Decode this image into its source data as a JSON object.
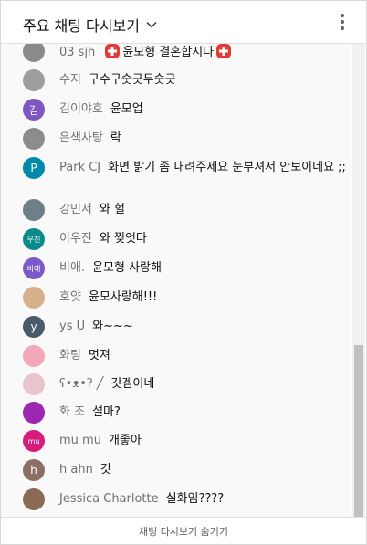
{
  "header": {
    "title": "주요 채팅 다시보기",
    "dropdown_icon": "chevron-down-icon",
    "menu_icon": "more-vert-icon"
  },
  "messages": [
    {
      "author": "03 sjh",
      "text": "윤모형 결혼합시다",
      "avatar_color": "#8a8a8a",
      "avatar_initial": "",
      "emoji": "red-cross"
    },
    {
      "author": "수지",
      "text": "구수구숫긋두숫긋",
      "avatar_color": "#9e9e9e",
      "avatar_initial": ""
    },
    {
      "author": "김이야호",
      "text": "윤모업",
      "avatar_color": "#7e57c2",
      "avatar_initial": "김"
    },
    {
      "author": "은색사탕",
      "text": "락",
      "avatar_color": "#8c8c8c",
      "avatar_initial": ""
    },
    {
      "author": "Park CJ",
      "text": "화면 밝기 좀 내려주세요 눈부셔서 안보이네요 ;;",
      "avatar_color": "#0288a8",
      "avatar_initial": "P"
    },
    {
      "author": "강민서",
      "text": "와 헐",
      "avatar_color": "#6f7f88",
      "avatar_initial": ""
    },
    {
      "author": "이우진",
      "text": "와 찢엇다",
      "avatar_color": "#0a8a8a",
      "avatar_initial": "우진"
    },
    {
      "author": "비애.",
      "text": "윤모형 사랑해",
      "avatar_color": "#7a5ac8",
      "avatar_initial": "비애"
    },
    {
      "author": "호얏",
      "text": "윤모사랑해!!!",
      "avatar_color": "#d9b08c",
      "avatar_initial": ""
    },
    {
      "author": "ys U",
      "text": "와~~~",
      "avatar_color": "#4a5a68",
      "avatar_initial": "y"
    },
    {
      "author": "화팅",
      "text": "멋져",
      "avatar_color": "#f2a8b8",
      "avatar_initial": ""
    },
    {
      "author": "ʕ•ᴥ•ʔ ╱",
      "text": "갓겜이네",
      "avatar_color": "#e8c4cc",
      "avatar_initial": ""
    },
    {
      "author": "화 조",
      "text": "설마?",
      "avatar_color": "#9c27b0",
      "avatar_initial": ""
    },
    {
      "author": "mu mu",
      "text": "개좋아",
      "avatar_color": "#d81b7a",
      "avatar_initial": "mu"
    },
    {
      "author": "h ahn",
      "text": "갓",
      "avatar_color": "#8d6e63",
      "avatar_initial": "h"
    },
    {
      "author": "Jessica Charlotte",
      "text": "실화임????",
      "avatar_color": "#8b6a52",
      "avatar_initial": ""
    }
  ],
  "footer": {
    "label": "채팅 다시보기 숨기기"
  }
}
